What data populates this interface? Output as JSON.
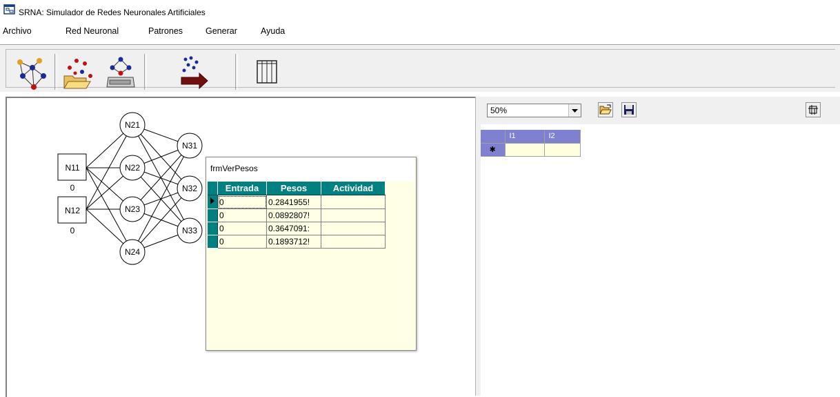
{
  "window": {
    "title": "SRNA: Simulador de Redes Neuronales Artificiales"
  },
  "menu": [
    {
      "label": "Archivo"
    },
    {
      "label": "Red Neuronal"
    },
    {
      "label": "Patrones"
    },
    {
      "label": "Generar"
    },
    {
      "label": "Ayuda"
    }
  ],
  "toolbar": {
    "buttons": [
      {
        "icon": "network-icon"
      },
      {
        "icon": "open-patterns-icon"
      },
      {
        "icon": "network-device-icon"
      },
      {
        "icon": "generate-arrow-icon"
      },
      {
        "icon": "table-view-icon"
      }
    ]
  },
  "network": {
    "nodes": {
      "input": [
        "N11",
        "N12"
      ],
      "hidden": [
        "N21",
        "N22",
        "N23",
        "N24"
      ],
      "output": [
        "N31",
        "N32",
        "N33"
      ]
    },
    "input_values": [
      "0",
      "0"
    ]
  },
  "right_panel": {
    "zoom": "50%",
    "grid_columns": [
      "I1",
      "I2"
    ],
    "new_row_marker": "✱"
  },
  "dialog": {
    "title": "frmVerPesos",
    "columns": [
      "Entrada",
      "Pesos",
      "Actividad"
    ],
    "rows": [
      {
        "entrada": "0",
        "pesos": "0.2841955!",
        "actividad": ""
      },
      {
        "entrada": "0",
        "pesos": "0.0892807!",
        "actividad": ""
      },
      {
        "entrada": "0",
        "pesos": "0.3647091:",
        "actividad": ""
      },
      {
        "entrada": "0",
        "pesos": "0.1893712!",
        "actividad": ""
      }
    ]
  },
  "colors": {
    "grid_header": "#8080d0",
    "table_header": "#008080",
    "cell_bg": "#ffffe0"
  }
}
